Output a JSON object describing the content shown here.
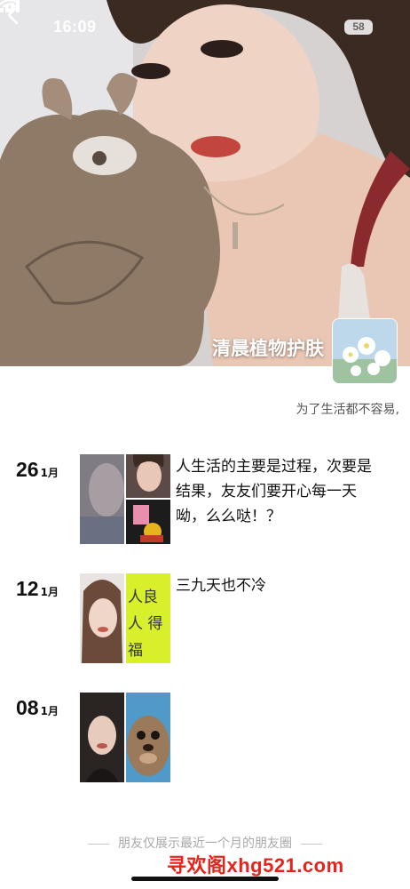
{
  "status_bar": {
    "time": "16:09",
    "battery": "58",
    "icons": [
      "signal-icon",
      "wifi-icon",
      "battery-icon"
    ]
  },
  "nav": {
    "back_icon": "chevron-left-icon"
  },
  "profile": {
    "name": "清晨植物护肤",
    "signature": "为了生活都不容易,",
    "cover_image": "selfie-with-plush-toy",
    "avatar_image": "white-flowers-sky"
  },
  "posts": [
    {
      "day": "26",
      "month": "1月",
      "text": "人生活的主要是过程，次要是结果，友友们要开心每一天呦，么么哒！？",
      "thumbnails": [
        "blurred-face-photo",
        "woman-selfie-photo",
        "cartoon-sticker-photo"
      ]
    },
    {
      "day": "12",
      "month": "1月",
      "text": "三九天也不冷",
      "thumbnails": [
        "woman-portrait-photo",
        "calligraphy-card-photo"
      ]
    },
    {
      "day": "08",
      "month": "1月",
      "text": "",
      "thumbnails": [
        "woman-portrait-photo",
        "seal-pup-photo"
      ]
    }
  ],
  "calligraphy_text": "人良人 得福",
  "footer": {
    "note": "朋友仅展示最近一个月的朋友圈"
  },
  "watermark": "寻欢阁xhg521.com",
  "colors": {
    "watermark": "#e8231a",
    "footer": "#a8a8a8"
  }
}
